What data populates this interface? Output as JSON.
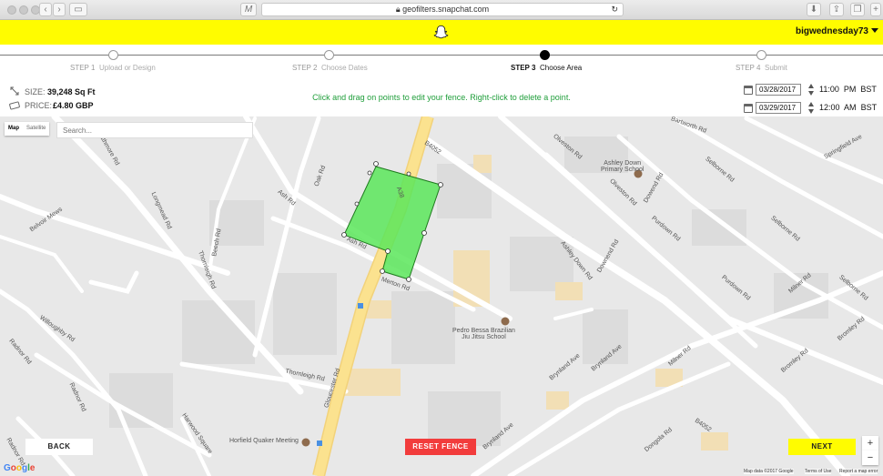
{
  "browser": {
    "url": "geofilters.snapchat.com"
  },
  "header": {
    "username": "bigwednesday73"
  },
  "steps": [
    {
      "num": "STEP 1",
      "label": "Upload or Design",
      "active": false
    },
    {
      "num": "STEP 2",
      "label": "Choose Dates",
      "active": false
    },
    {
      "num": "STEP 3",
      "label": "Choose Area",
      "active": true
    },
    {
      "num": "STEP 4",
      "label": "Submit",
      "active": false
    }
  ],
  "info": {
    "size_label": "SIZE:",
    "size_value": "39,248 Sq Ft",
    "price_label": "PRICE:",
    "price_value": "£4.80 GBP"
  },
  "instruction": "Click and drag on points to edit your fence. Right-click to delete a point.",
  "schedule": {
    "start_date": "03/28/2017",
    "start_time": "11:00",
    "start_ampm": "PM",
    "start_tz": "BST",
    "end_date": "03/29/2017",
    "end_time": "12:00",
    "end_ampm": "AM",
    "end_tz": "BST"
  },
  "map": {
    "type_map": "Map",
    "type_satellite": "Satellite",
    "search_placeholder": "Search...",
    "zoom_in": "+",
    "zoom_out": "−",
    "labels": {
      "ashley_down": "Ashley Down\nPrimary School",
      "pedro": "Pedro Bessa Brazilian\nJiu Jitsu School",
      "horfield": "Horfield Quaker Meeting",
      "gloucester": "Gloucester Rd",
      "thornleigh": "Thornleigh Rd",
      "merton": "Merton Rd",
      "ash": "Ash Rd",
      "oak": "Oak Rd",
      "a38": "A38",
      "b4052": "B4052",
      "b4052b": "B4052",
      "ashley_down_rd": "Ashley Down Rd",
      "downend": "Downend Rd",
      "olveston": "Olveston Rd",
      "selborne": "Selborne Rd",
      "selborne2": "Selborne Rd",
      "selborne3": "Selborne Rd",
      "purdown": "Purdown Rd",
      "purdown2": "Purdown Rd",
      "bromley": "Bromley Rd",
      "bromley2": "Bromley Rd",
      "milner": "Milner Rd",
      "milner2": "Milner Rd",
      "brynland": "Brynland Ave",
      "brynland2": "Brynland Ave",
      "brynland3": "Brynland Ave",
      "dongola": "Dongola Rd",
      "springfield": "Springfield Ave",
      "beech": "Beech Rd",
      "thorneigh": "Thornleigh Rd",
      "longmead": "Longmead Rd",
      "radnor": "Radnor Rd",
      "radnor2": "Radnor Rd",
      "willoughby": "Willoughby Rd",
      "harwood": "Harwood Square",
      "belvoir": "Belvoir Mews",
      "bartworth": "Bartworth Rd",
      "strathmore": "Strathmore Rd",
      "dowend": "Dowend Rd",
      "ash_rd_2": "Ash Rd",
      "olveston2": "Olveston Rd",
      "radnor3": "Radnor Rd"
    },
    "attribution": "Map data ©2017 Google",
    "terms": "Terms of Use",
    "report": "Report a map error",
    "google": "Google"
  },
  "buttons": {
    "back": "BACK",
    "reset": "RESET FENCE",
    "next": "NEXT"
  },
  "colors": {
    "snap_yellow": "#fffc00",
    "fence_green": "#5be65b",
    "reset_red": "#f23c3c",
    "instruction_green": "#1f9e3a",
    "road_yellow": "#fbe28f"
  }
}
